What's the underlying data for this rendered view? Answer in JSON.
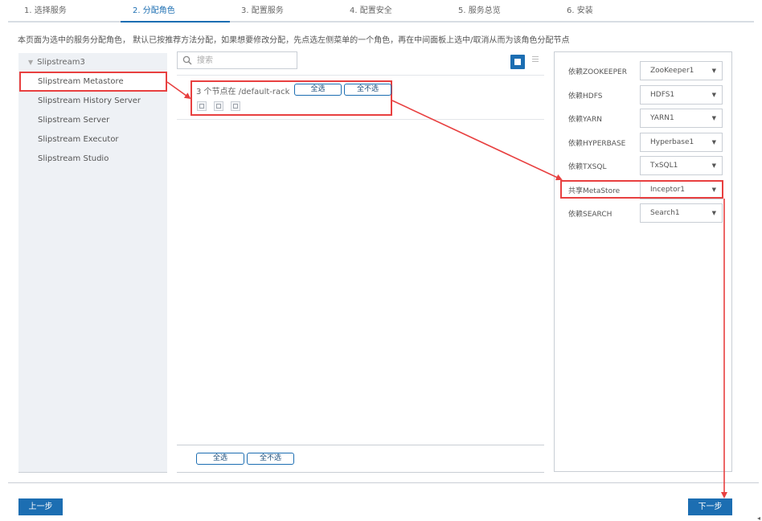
{
  "steps": [
    {
      "label": "1. 选择服务"
    },
    {
      "label": "2. 分配角色"
    },
    {
      "label": "3. 配置服务"
    },
    {
      "label": "4. 配置安全"
    },
    {
      "label": "5. 服务总览"
    },
    {
      "label": "6. 安装"
    }
  ],
  "active_step": 2,
  "description": "本页面为选中的服务分配角色， 默认已按推荐方法分配，如果想要修改分配，先点选左侧菜单的一个角色，再在中间面板上选中/取消从而为该角色分配节点",
  "roles": {
    "group": "Slipstream3",
    "items": [
      {
        "label": "Slipstream Metastore"
      },
      {
        "label": "Slipstream History Server"
      },
      {
        "label": "Slipstream Server"
      },
      {
        "label": "Slipstream Executor"
      },
      {
        "label": "Slipstream Studio"
      }
    ],
    "selected_index": 0
  },
  "search": {
    "placeholder": "搜索"
  },
  "rack": {
    "label": "3 个节点在 /default-rack",
    "select_all": "全选",
    "select_none": "全不选",
    "node_count": 3
  },
  "bottom": {
    "select_all": "全选",
    "select_none": "全不选"
  },
  "dependencies": [
    {
      "label": "依赖ZOOKEEPER",
      "value": "ZooKeeper1"
    },
    {
      "label": "依赖HDFS",
      "value": "HDFS1"
    },
    {
      "label": "依赖YARN",
      "value": "YARN1"
    },
    {
      "label": "依赖HYPERBASE",
      "value": "Hyperbase1"
    },
    {
      "label": "依赖TXSQL",
      "value": "TxSQL1"
    },
    {
      "label": "共享MetaStore",
      "value": "Inceptor1"
    },
    {
      "label": "依赖SEARCH",
      "value": "Search1"
    }
  ],
  "nav": {
    "prev": "上一步",
    "next": "下一步"
  },
  "colors": {
    "accent": "#1c6eb2",
    "annotation": "#e84040"
  }
}
